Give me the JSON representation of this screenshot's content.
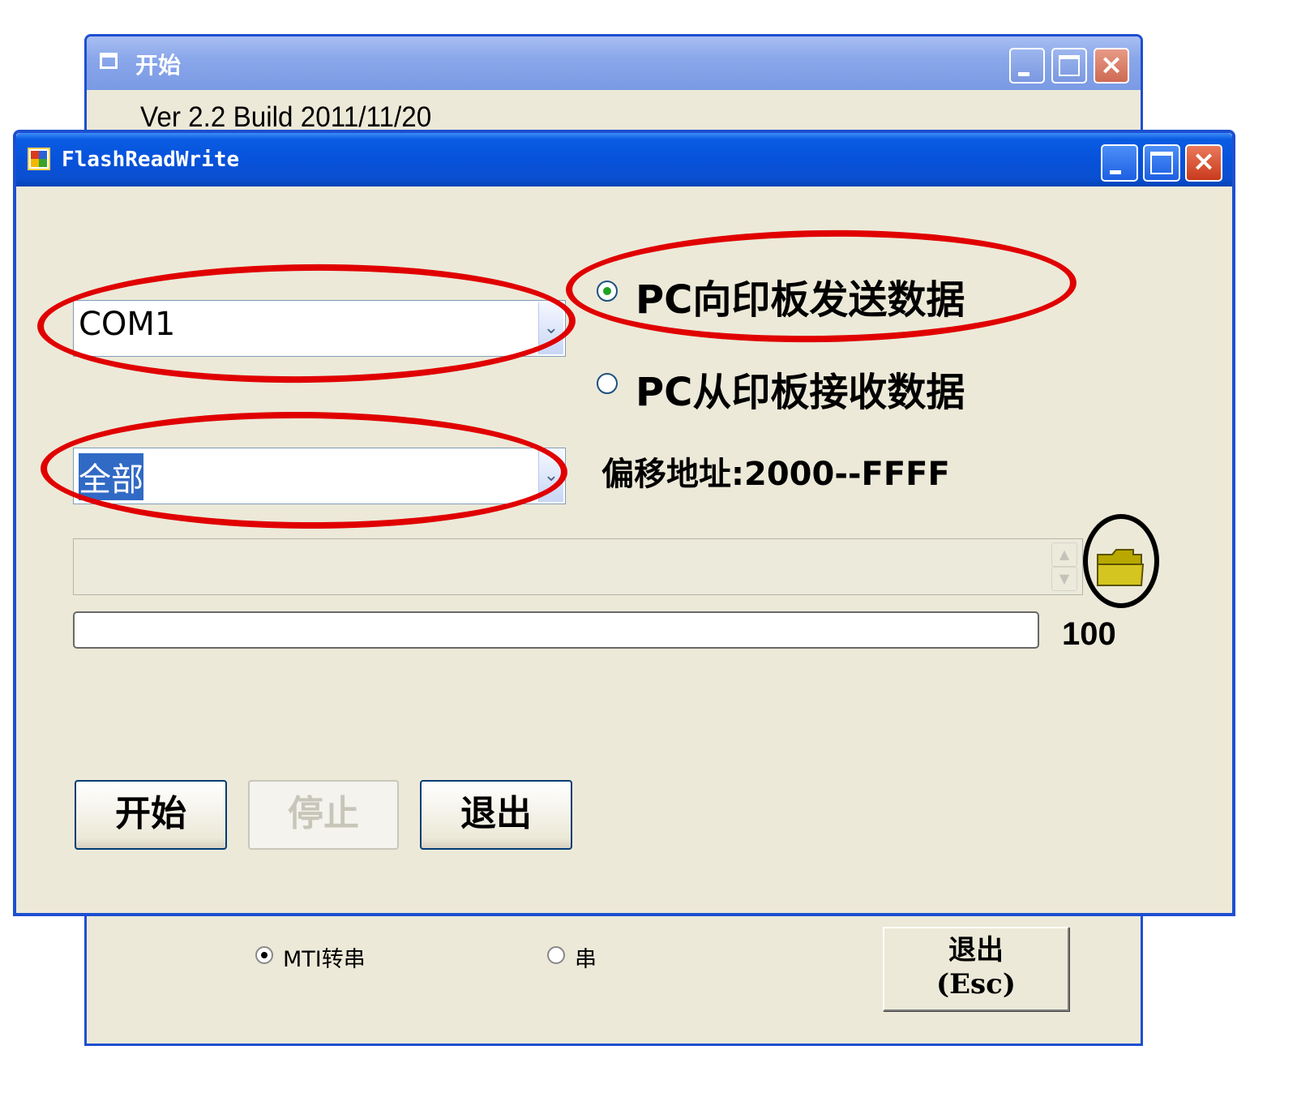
{
  "back_window": {
    "title": "开始",
    "version": "Ver 2.2 Build 2011/11/20",
    "radio_mti": "MTI转串",
    "radio_serial": "串",
    "exit_line1": "退出",
    "exit_line2": "(Esc)"
  },
  "front_window": {
    "title": "FlashReadWrite",
    "port_select": "COM1",
    "range_select": "全部",
    "radio_send": "PC向印板发送数据",
    "radio_receive": "PC从印板接收数据",
    "offset_label": "偏移地址:2000--FFFF",
    "file_path": "",
    "progress_value": "100",
    "progress_fraction": 0,
    "buttons": {
      "start": "开始",
      "stop": "停止",
      "exit": "退出"
    }
  },
  "colors": {
    "highlight_ellipse": "#e00000",
    "folder_ellipse": "#000000",
    "title_active": "#0752db",
    "window_bg": "#ece9d8"
  }
}
